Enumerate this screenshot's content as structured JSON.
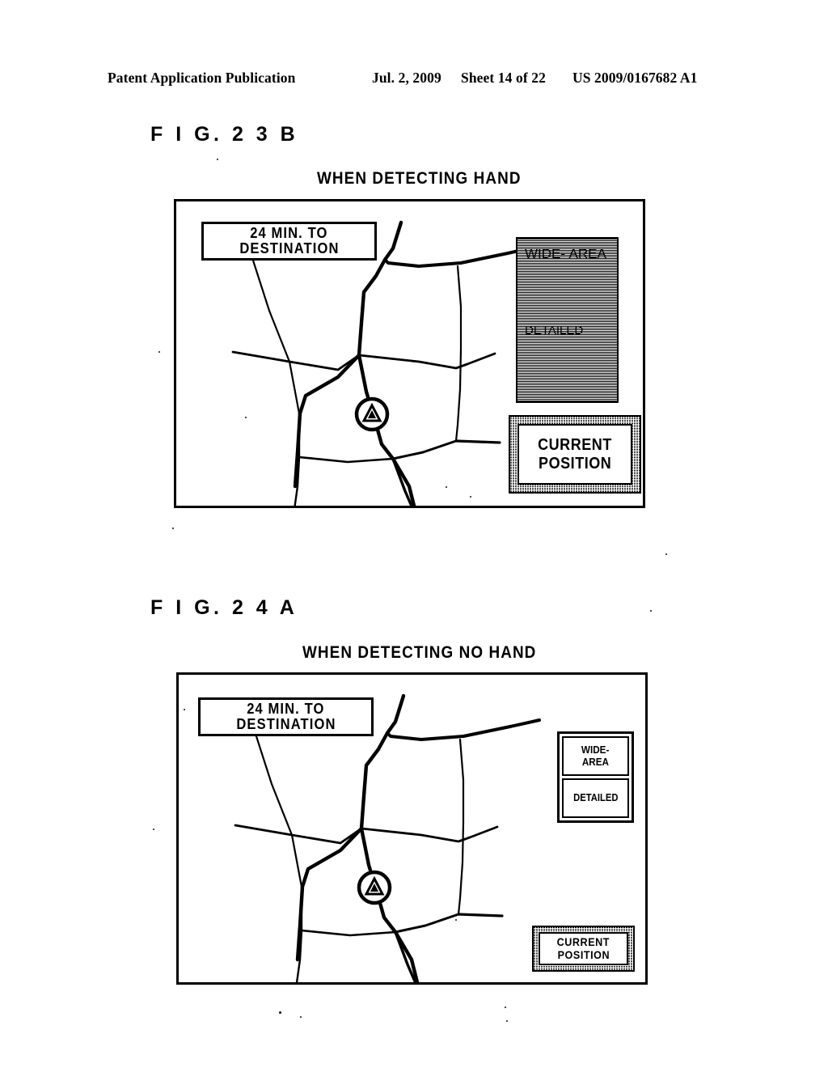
{
  "header": {
    "publication": "Patent Application Publication",
    "date": "Jul. 2, 2009",
    "sheet": "Sheet 14 of 22",
    "number": "US 2009/0167682 A1"
  },
  "figures": [
    {
      "label": "F I G.  2 3 B",
      "caption": "WHEN DETECTING HAND",
      "destination_banner": {
        "line1": "24 MIN. TO",
        "line2": "DESTINATION"
      },
      "buttons": {
        "wide_area": {
          "line1": "WIDE-",
          "line2": "AREA"
        },
        "detailed": {
          "line1": "DETAILED"
        },
        "current_position": {
          "line1": "CURRENT",
          "line2": "POSITION"
        }
      },
      "marker": "vehicle-position-marker"
    },
    {
      "label": "F I G.  2 4 A",
      "caption": "WHEN DETECTING NO HAND",
      "destination_banner": {
        "line1": "24 MIN. TO",
        "line2": "DESTINATION"
      },
      "buttons": {
        "wide_area": {
          "line1": "WIDE-",
          "line2": "AREA"
        },
        "detailed": {
          "line1": "DETAILED"
        },
        "current_position": {
          "line1": "CURRENT",
          "line2": "POSITION"
        }
      },
      "marker": "vehicle-position-marker"
    }
  ],
  "colors": {
    "ink": "#000000",
    "paper": "#ffffff"
  }
}
